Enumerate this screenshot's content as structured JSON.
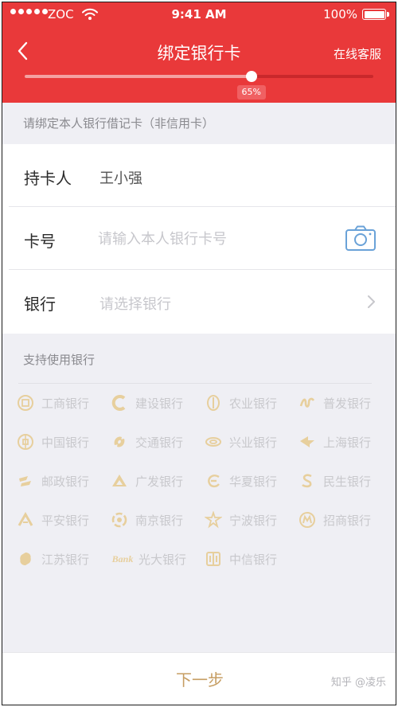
{
  "status_bar": {
    "carrier": "ZOC",
    "time": "9:41 AM",
    "battery": "100%"
  },
  "nav": {
    "title": "绑定银行卡",
    "service": "在线客服"
  },
  "progress": {
    "value": 0.65,
    "label": "65%"
  },
  "notice": "请绑定本人银行借记卡（非信用卡）",
  "form": {
    "holder_label": "持卡人",
    "holder_value": "王小强",
    "card_label": "卡号",
    "card_placeholder": "请输入本人银行卡号",
    "bank_label": "银行",
    "bank_placeholder": "请选择银行"
  },
  "banks": {
    "title": "支持使用银行",
    "items": [
      {
        "name": "工商银行",
        "icon": "icbc-logo-icon"
      },
      {
        "name": "建设银行",
        "icon": "ccb-logo-icon"
      },
      {
        "name": "农业银行",
        "icon": "abc-logo-icon"
      },
      {
        "name": "普发银行",
        "icon": "spdb-logo-icon"
      },
      {
        "name": "中国银行",
        "icon": "boc-logo-icon"
      },
      {
        "name": "交通银行",
        "icon": "bocom-logo-icon"
      },
      {
        "name": "兴业银行",
        "icon": "cib-logo-icon"
      },
      {
        "name": "上海银行",
        "icon": "bosc-logo-icon"
      },
      {
        "name": "邮政银行",
        "icon": "psbc-logo-icon"
      },
      {
        "name": "广发银行",
        "icon": "cgb-logo-icon"
      },
      {
        "name": "华夏银行",
        "icon": "hxb-logo-icon"
      },
      {
        "name": "民生银行",
        "icon": "cmbc-logo-icon"
      },
      {
        "name": "平安银行",
        "icon": "pab-logo-icon"
      },
      {
        "name": "南京银行",
        "icon": "njcb-logo-icon"
      },
      {
        "name": "宁波银行",
        "icon": "nbcb-logo-icon"
      },
      {
        "name": "招商银行",
        "icon": "cmb-logo-icon"
      },
      {
        "name": "江苏银行",
        "icon": "jsb-logo-icon"
      },
      {
        "name": "光大银行",
        "icon": "ceb-logo-icon",
        "logo_text": "Bank"
      },
      {
        "name": "中信银行",
        "icon": "citic-logo-icon"
      }
    ]
  },
  "footer": {
    "next_label": "下一步",
    "watermark": "知乎 @凌乐"
  },
  "colors": {
    "header": "#e9393a",
    "accent_gold": "#c69d62",
    "bank_logo": "#e7cf9d"
  }
}
